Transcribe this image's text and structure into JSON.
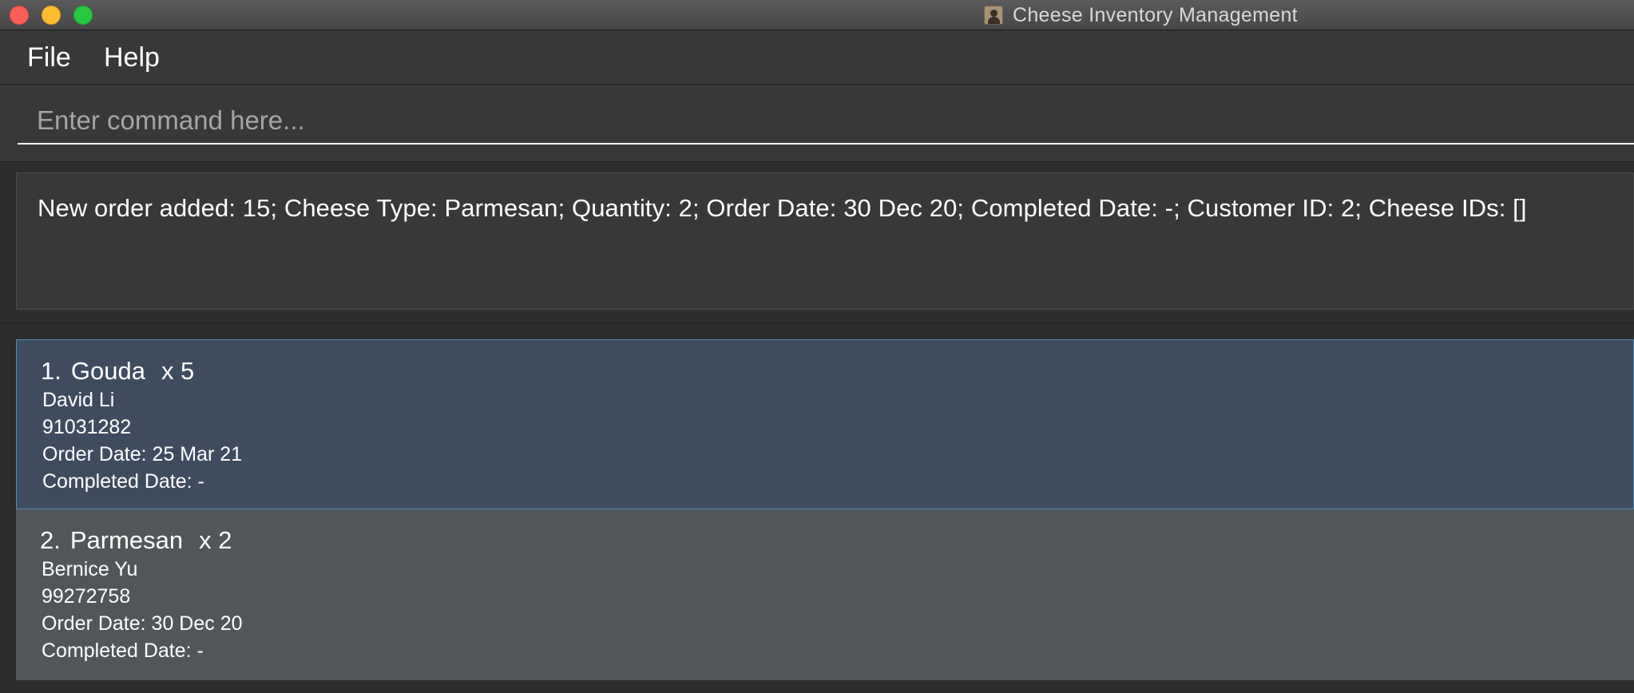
{
  "window": {
    "title": "Cheese Inventory Management"
  },
  "menu": {
    "items": [
      "File",
      "Help"
    ]
  },
  "command": {
    "placeholder": "Enter command here...",
    "value": ""
  },
  "result": {
    "text": "New order added: 15; Cheese Type: Parmesan; Quantity: 2; Order Date: 30 Dec 20; Completed Date: -; Customer ID: 2; Cheese IDs: []"
  },
  "orders": [
    {
      "index": "1.",
      "cheese_type": "Gouda",
      "quantity": "x 5",
      "customer": "David Li",
      "phone": "91031282",
      "order_date": "Order Date: 25 Mar 21",
      "completed_date": "Completed Date: -",
      "selected": true
    },
    {
      "index": "2.",
      "cheese_type": "Parmesan",
      "quantity": "x 2",
      "customer": "Bernice Yu",
      "phone": "99272758",
      "order_date": "Order Date: 30 Dec 20",
      "completed_date": "Completed Date: -",
      "selected": false
    }
  ],
  "colors": {
    "background": "#2d2d2d",
    "panel": "#383838",
    "selected_card": "#3f4c60",
    "selected_border": "#4f8bb5",
    "card": "#515658",
    "close": "#fc5f57",
    "minimize": "#fdbc2e",
    "maximize": "#28c840"
  },
  "icons": {
    "app": "person-contact-icon"
  }
}
